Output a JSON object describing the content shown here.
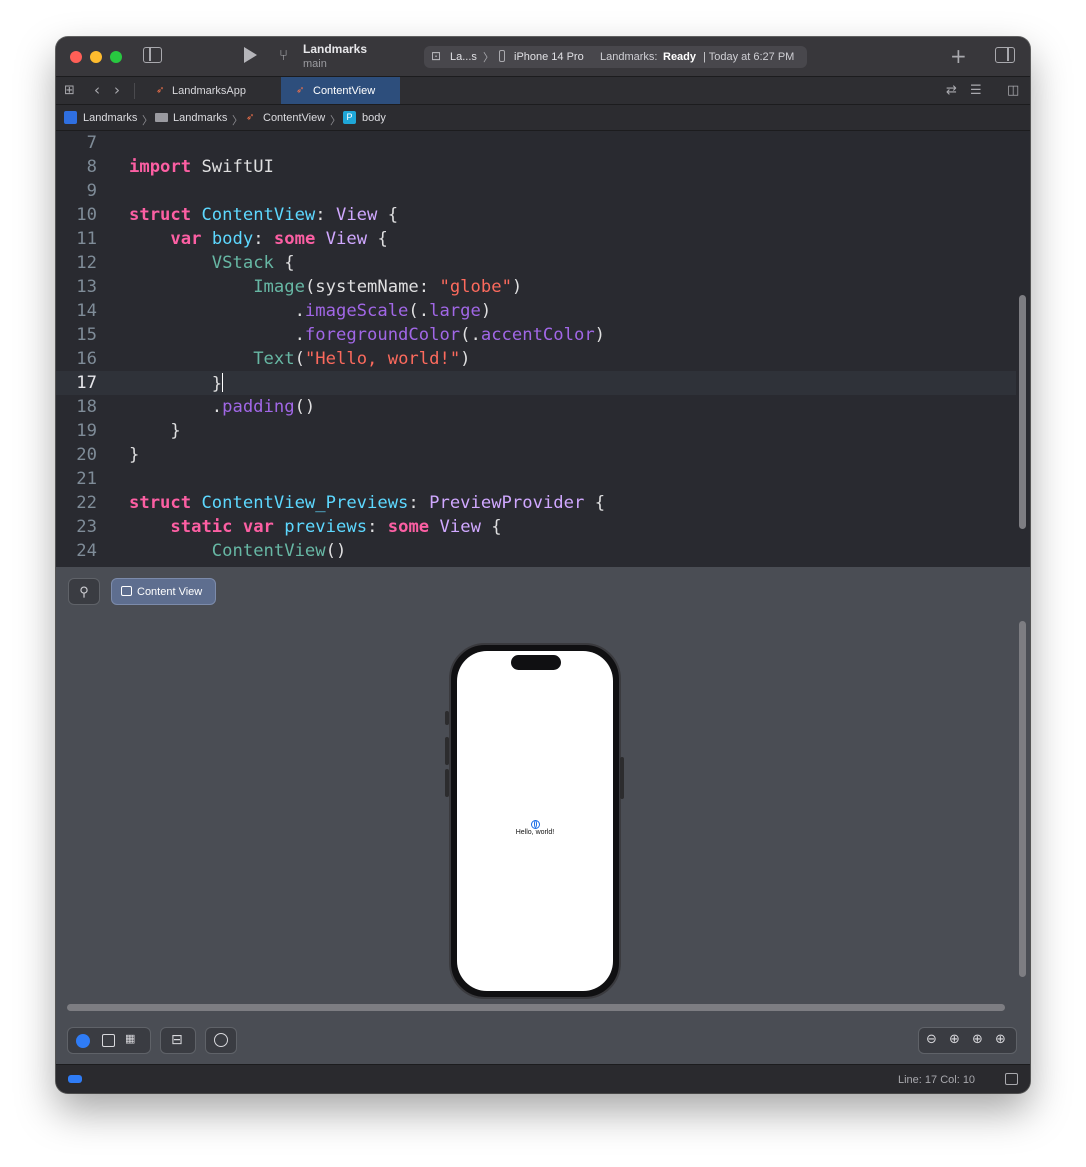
{
  "titlebar": {
    "project_name": "Landmarks",
    "branch": "main",
    "scheme": "La...s",
    "device": "iPhone 14 Pro",
    "status_prefix": "Landmarks:",
    "status_state": "Ready",
    "status_time": "| Today at 6:27 PM"
  },
  "tabs": [
    {
      "label": "LandmarksApp",
      "active": false
    },
    {
      "label": "ContentView",
      "active": true
    }
  ],
  "breadcrumb": [
    "Landmarks",
    "Landmarks",
    "ContentView",
    "body"
  ],
  "editor": {
    "current_line": 17,
    "lines": [
      {
        "n": "7",
        "text": ""
      },
      {
        "n": "8",
        "text": "import SwiftUI"
      },
      {
        "n": "9",
        "text": ""
      },
      {
        "n": "10",
        "text": "struct ContentView: View {"
      },
      {
        "n": "11",
        "text": "    var body: some View {"
      },
      {
        "n": "12",
        "text": "        VStack {"
      },
      {
        "n": "13",
        "text": "            Image(systemName: \"globe\")"
      },
      {
        "n": "14",
        "text": "                .imageScale(.large)"
      },
      {
        "n": "15",
        "text": "                .foregroundColor(.accentColor)"
      },
      {
        "n": "16",
        "text": "            Text(\"Hello, world!\")"
      },
      {
        "n": "17",
        "text": "        }"
      },
      {
        "n": "18",
        "text": "        .padding()"
      },
      {
        "n": "19",
        "text": "    }"
      },
      {
        "n": "20",
        "text": "}"
      },
      {
        "n": "21",
        "text": ""
      },
      {
        "n": "22",
        "text": "struct ContentView_Previews: PreviewProvider {"
      },
      {
        "n": "23",
        "text": "    static var previews: some View {"
      },
      {
        "n": "24",
        "text": "        ContentView()"
      }
    ]
  },
  "canvas": {
    "preview_button_label": "Content View",
    "device_text": "Hello, world!"
  },
  "statusbar": {
    "cursor_position": "Line: 17  Col: 10"
  },
  "colors": {
    "keyword": "#fc5fa3",
    "type": "#5dd8ff",
    "string": "#fc6a5d",
    "method": "#a167e6",
    "accent": "#2d4e7c"
  }
}
